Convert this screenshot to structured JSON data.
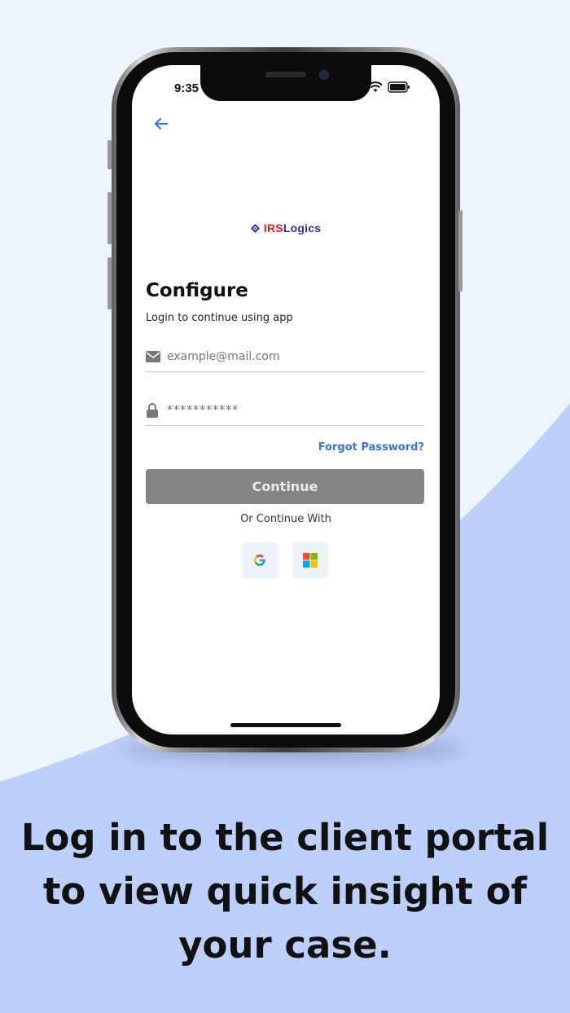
{
  "colors": {
    "background": "#eef4fd",
    "accent_shape": "#bcd0fb",
    "link": "#3a74d4",
    "button": "#858585",
    "logo_red": "#d42028",
    "logo_blue": "#2b2f9a"
  },
  "status_bar": {
    "time": "9:35",
    "icons": [
      "wifi-icon",
      "battery-icon"
    ]
  },
  "header": {
    "back_icon": "arrow-left-icon"
  },
  "logo": {
    "part1": "IRS",
    "part2": "Logics"
  },
  "form": {
    "title": "Configure",
    "subtitle": "Login to continue using app",
    "email_placeholder": "example@mail.com",
    "password_value": "***********",
    "forgot_label": "Forgot Password?",
    "continue_label": "Continue",
    "or_label": "Or Continue With",
    "social_icons": [
      "google-icon",
      "microsoft-icon"
    ]
  },
  "caption": {
    "line1": "Log in to the client portal",
    "line2": "to view quick insight of",
    "line3": "your case."
  }
}
